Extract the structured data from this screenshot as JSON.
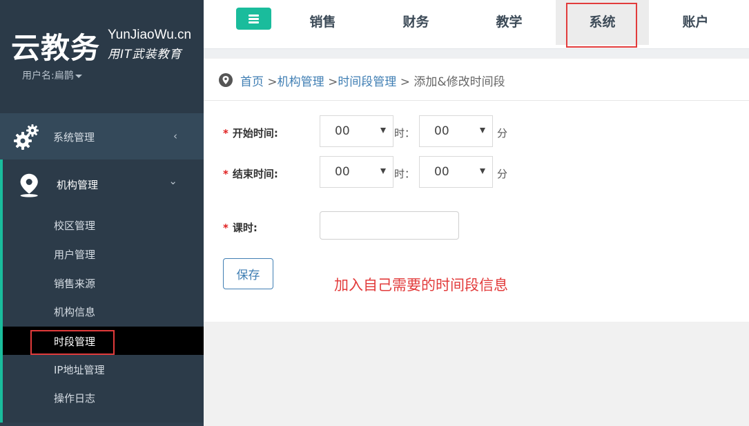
{
  "brand": {
    "logo_cn": "云教务",
    "logo_en": "YunJiaoWu.cn",
    "slogan": "用IT武装教育",
    "user_label": "用户名:扁鹊"
  },
  "sidebar": {
    "groups": [
      {
        "label": "系统管理",
        "icon": "gears-icon",
        "chevron": "‹",
        "expanded": false
      },
      {
        "label": "机构管理",
        "icon": "map-pin-icon",
        "chevron": "⌄",
        "expanded": true,
        "items": [
          {
            "label": "校区管理"
          },
          {
            "label": "用户管理"
          },
          {
            "label": "销售来源"
          },
          {
            "label": "机构信息"
          },
          {
            "label": "时段管理",
            "active": true
          },
          {
            "label": "IP地址管理"
          },
          {
            "label": "操作日志"
          }
        ]
      }
    ]
  },
  "topnav": {
    "menu_icon": "hamburger-icon",
    "tabs": [
      {
        "label": "销售"
      },
      {
        "label": "财务"
      },
      {
        "label": "教学"
      },
      {
        "label": "系统",
        "active": true
      },
      {
        "label": "账户"
      }
    ]
  },
  "breadcrumb": {
    "icon": "location-pin-icon",
    "items": [
      "首页",
      "机构管理",
      "时间段管理"
    ],
    "separator": ">",
    "current": "添加&修改时间段"
  },
  "form": {
    "start_label": "开始时间:",
    "end_label": "结束时间:",
    "hours_label": "课时:",
    "required_mark": "*",
    "hour_unit": "时：",
    "minute_unit": "分",
    "start_hour": "00",
    "start_minute": "00",
    "end_hour": "00",
    "end_minute": "00",
    "hours_value": "",
    "save_label": "保存"
  },
  "annotation": {
    "note": "加入自己需要的时间段信息",
    "color": "#e23b3b"
  },
  "colors": {
    "accent": "#1abc9c",
    "sidebar": "#2f3f4e",
    "link": "#3f7eb3"
  }
}
